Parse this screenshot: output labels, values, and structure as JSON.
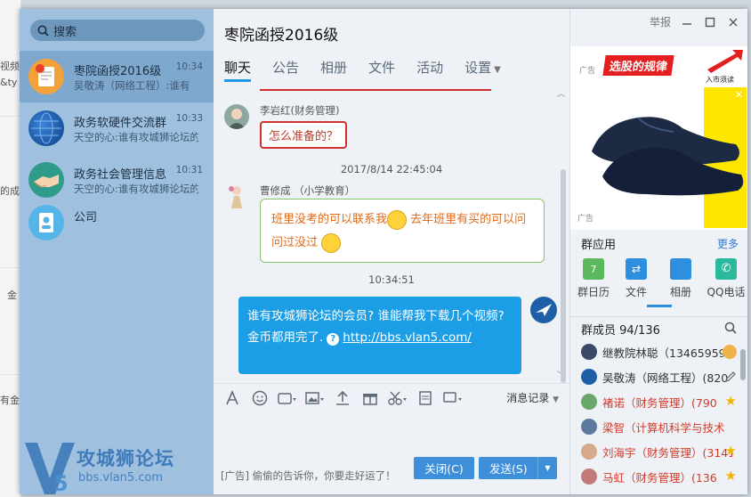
{
  "background": {
    "frag1": "视频",
    "frag2": "&ty",
    "frag3": "的成",
    "frag4": "金",
    "frag5": "有金"
  },
  "sidebar": {
    "search_placeholder": "搜索",
    "conversations": [
      {
        "name": "枣院函授2016级",
        "preview": "吴敬涛（网络工程）:谁有",
        "time": "10:34"
      },
      {
        "name": "政务软硬件交流群",
        "preview": "天空的心:谁有攻城狮论坛的",
        "time": "10:33"
      },
      {
        "name": "政务社会管理信息",
        "preview": "天空的心:谁有攻城狮论坛的",
        "time": "10:31"
      },
      {
        "name": "公司",
        "preview": "",
        "time": ""
      }
    ]
  },
  "chat": {
    "title": "枣院函授2016级",
    "tabs": [
      "聊天",
      "公告",
      "相册",
      "文件",
      "活动",
      "设置"
    ],
    "messages": {
      "m1_sender": "李岩红(财务管理)",
      "m1_text": "怎么准备的？",
      "ts1": "2017/8/14 22:45:04",
      "m2_sender": "曹修成 （小学教育）",
      "m2_text_a": "班里没考的可以联系我",
      "m2_text_b": "去年班里有买的可以问",
      "m2_text_c": "问过没过",
      "ts2": "10:34:51",
      "m3_text": "谁有攻城狮论坛的会员? 谁能帮我下载几个视频? 金币都用完了.",
      "m3_link": "http://bbs.vlan5.com/"
    },
    "history_label": "消息记录",
    "ad_text": "[广告] 偷偷的告诉你，你要走好运了！",
    "close_label": "关闭(C)",
    "send_label": "发送(S)"
  },
  "right": {
    "report_label": "举报",
    "ad_banner": "选股的规律",
    "ad_sub": "入市须读",
    "ad_tag": "广告",
    "group_apps_label": "群应用",
    "more_label": "更多",
    "apps": [
      "群日历",
      "文件",
      "相册",
      "QQ电话"
    ],
    "members_label": "群成员 94/136",
    "members": [
      {
        "name": "继教院林聪（13465959",
        "color": "#222"
      },
      {
        "name": "吴敬涛（网络工程）(820",
        "color": "#222"
      },
      {
        "name": "褚诺（财务管理）(790",
        "color": "#d23b2b"
      },
      {
        "name": "梁智（计算机科学与技术",
        "color": "#d23b2b"
      },
      {
        "name": "刘海宇（财务管理）(3141",
        "color": "#d23b2b"
      },
      {
        "name": "马虹（财务管理）(136",
        "color": "#d23b2b"
      }
    ]
  },
  "watermark": {
    "title": "攻城狮论坛",
    "url": "bbs.vlan5.com"
  }
}
